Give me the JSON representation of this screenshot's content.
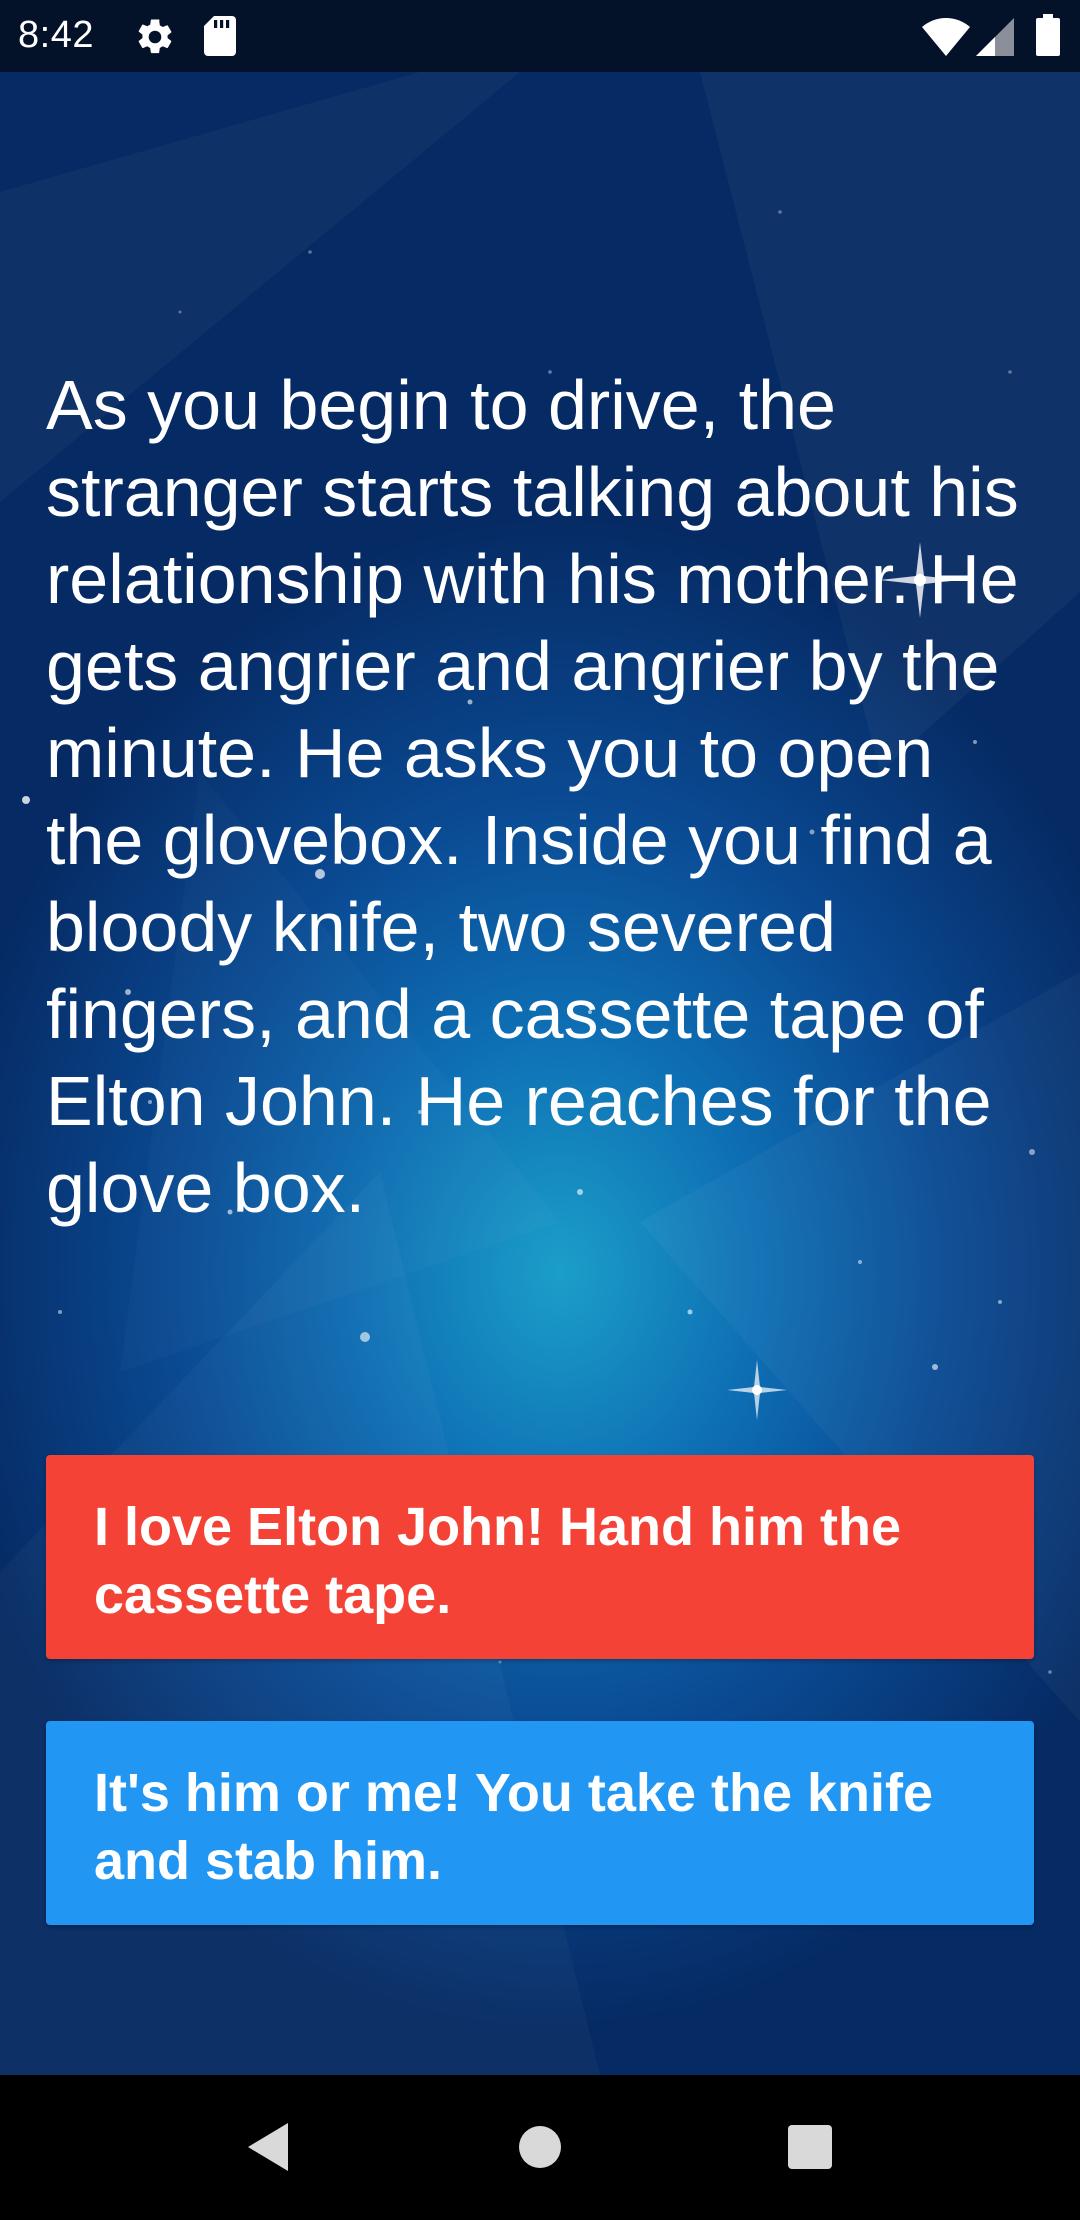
{
  "status_bar": {
    "time": "8:42",
    "icons": [
      "gear-icon",
      "sdcard-icon",
      "wifi-icon",
      "signal-icon",
      "battery-icon"
    ]
  },
  "story": {
    "text": "As you begin to drive, the stranger starts talking about his relationship with his mother. He gets angrier and angrier by the minute. He asks you to open the glovebox. Inside you find a bloody knife, two severed fingers, and a cassette tape of Elton John. He reaches for the glove box."
  },
  "choices": [
    {
      "label": "I love Elton John! Hand him the cassette tape.",
      "color": "#f44336"
    },
    {
      "label": "It's him or me! You take the knife and stab him.",
      "color": "#2196f3"
    }
  ],
  "nav_bar": {
    "icons": [
      "back-icon",
      "home-icon",
      "recents-icon"
    ]
  },
  "theme": {
    "background_center": "#1b9ec9",
    "background_edge": "#062a63",
    "status_bar": "#031129",
    "text": "#ffffff"
  }
}
